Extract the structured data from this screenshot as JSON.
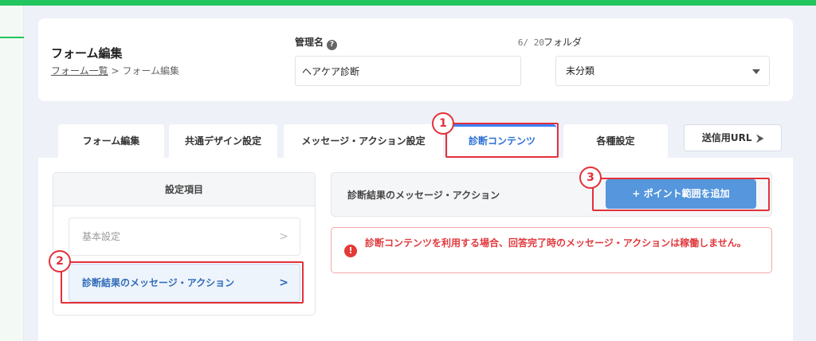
{
  "header": {
    "title": "フォーム編集",
    "breadcrumb_link": "フォーム一覧",
    "breadcrumb_sep": " > ",
    "breadcrumb_current": "フォーム編集",
    "name_label": "管理名",
    "name_counter": "6/ 20",
    "name_value": "ヘアケア診断",
    "folder_label": "フォルダ",
    "folder_value": "未分類"
  },
  "tabs": [
    {
      "label": "フォーム編集"
    },
    {
      "label": "共通デザイン設定"
    },
    {
      "label": "メッセージ・アクション設定"
    },
    {
      "label": "診断コンテンツ",
      "active": true
    },
    {
      "label": "各種設定"
    }
  ],
  "send_url": {
    "label": "送信用URL"
  },
  "settings": {
    "heading": "設定項目",
    "items": [
      {
        "label": "基本設定"
      },
      {
        "label": "診断結果のメッセージ・アクション",
        "active": true
      }
    ]
  },
  "result": {
    "title": "診断結果のメッセージ・アクション",
    "add_button": "+ ポイント範囲を追加"
  },
  "warning": {
    "text": "診断コンテンツを利用する場合、回答完了時のメッセージ・アクションは稼働しません。"
  },
  "annotations": [
    "1",
    "2",
    "3"
  ],
  "colors": {
    "brand_green": "#22c55e",
    "active_blue": "#2b6fd6",
    "button_blue": "#5596dc",
    "annotation_red": "#e3313a",
    "warning_red": "#e0393e"
  }
}
